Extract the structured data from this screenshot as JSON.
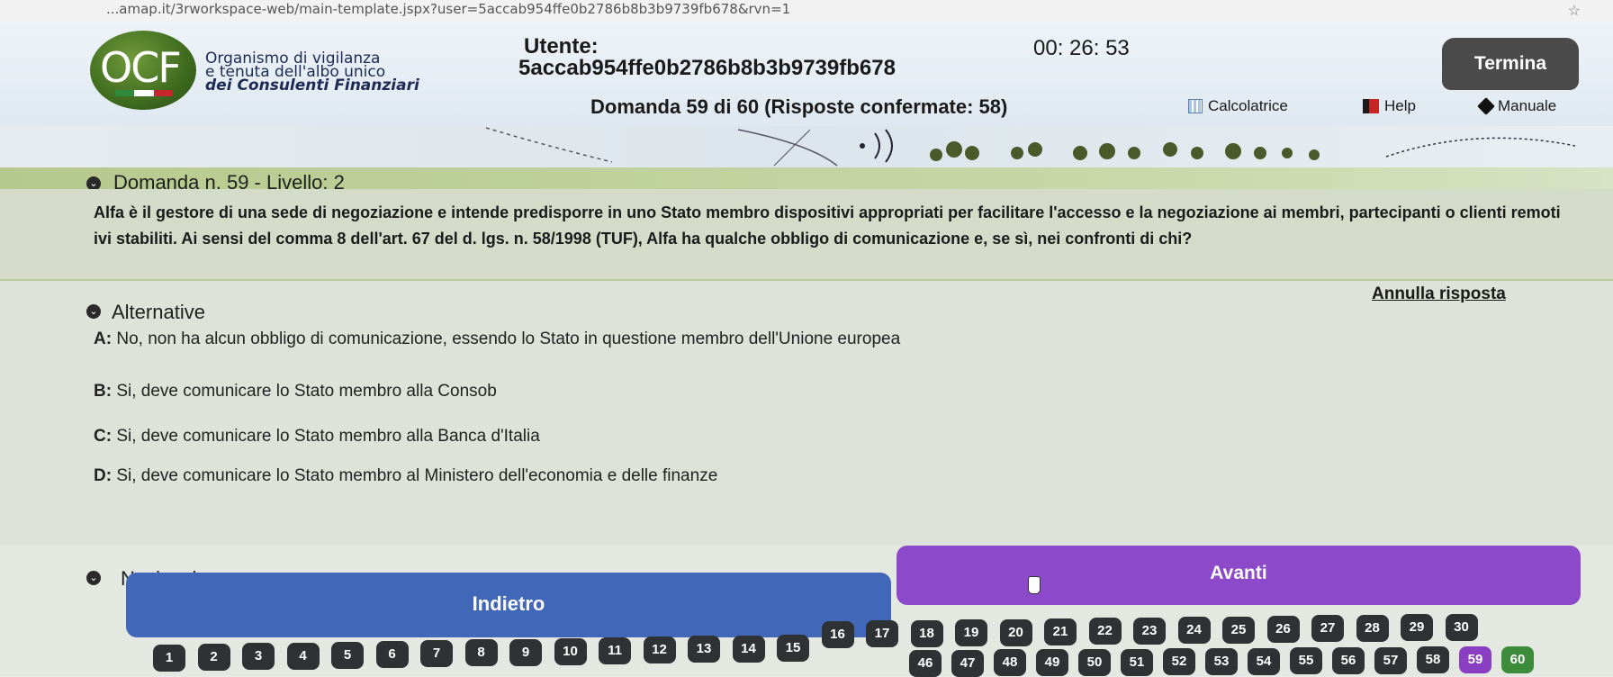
{
  "browser": {
    "url": "...amap.it/3rworkspace-web/main-template.jspx?user=5accab954ffe0b2786b8b3b9739fb678&rvn=1"
  },
  "header": {
    "logo_text": "OCF",
    "org_line1": "Organismo di vigilanza",
    "org_line2": "e tenuta dell'albo unico",
    "org_line3": "dei Consulenti Finanziari",
    "user_label": "Utente:",
    "user_id": "5accab954ffe0b2786b8b3b9739fb678",
    "timer": "00: 26: 53",
    "end_button": "Termina",
    "question_counter": "Domanda 59 di 60 (Risposte confermate: 58)",
    "tools": {
      "calculator": "Calcolatrice",
      "help": "Help",
      "manual": "Manuale"
    },
    "flag_colors": [
      "#2d8a3a",
      "#ffffff",
      "#c8262c"
    ]
  },
  "question": {
    "title": "Domanda n. 59 - Livello: 2",
    "text": "Alfa è il gestore di una sede di negoziazione e intende predisporre in uno Stato membro dispositivi appropriati per facilitare l'accesso e la negoziazione ai membri, partecipanti o clienti remoti ivi stabiliti. Ai sensi del comma 8 dell'art. 67 del d. lgs. n. 58/1998 (TUF), Alfa ha qualche obbligo di comunicazione e, se sì, nei confronti di chi?"
  },
  "alternatives": {
    "title": "Alternative",
    "cancel_label": "Annulla risposta",
    "items": [
      {
        "letter": "A:",
        "text": "No, non ha alcun obbligo di comunicazione, essendo lo Stato in questione membro dell'Unione europea"
      },
      {
        "letter": "B:",
        "text": "Si, deve comunicare lo Stato membro alla Consob"
      },
      {
        "letter": "C:",
        "text": "Si, deve comunicare lo Stato membro alla Banca d'Italia"
      },
      {
        "letter": "D:",
        "text": "Si, deve comunicare lo Stato membro al Ministero dell'economia e delle finanze"
      }
    ]
  },
  "navigation": {
    "title": "Navigazione",
    "back_label": "Indietro",
    "next_label": "Avanti",
    "current_question": 59,
    "total_questions": 60,
    "visible_numbers_bottom_row": [
      "1",
      "2",
      "3",
      "4",
      "5",
      "6",
      "7",
      "8",
      "9",
      "10",
      "11",
      "12",
      "13",
      "14",
      "15",
      "16",
      "17",
      "18",
      "19",
      "20",
      "21",
      "22",
      "23",
      "24",
      "25",
      "26",
      "27",
      "28",
      "29",
      "30"
    ],
    "visible_numbers_top_row_partial": [
      "46",
      "47",
      "48",
      "49",
      "50",
      "51",
      "52",
      "53",
      "54",
      "55",
      "56",
      "57",
      "58",
      "59",
      "60"
    ],
    "colors": {
      "answered": "#2f3234",
      "current": "#8a3fc2",
      "unanswered": "#3c8c3c"
    }
  }
}
